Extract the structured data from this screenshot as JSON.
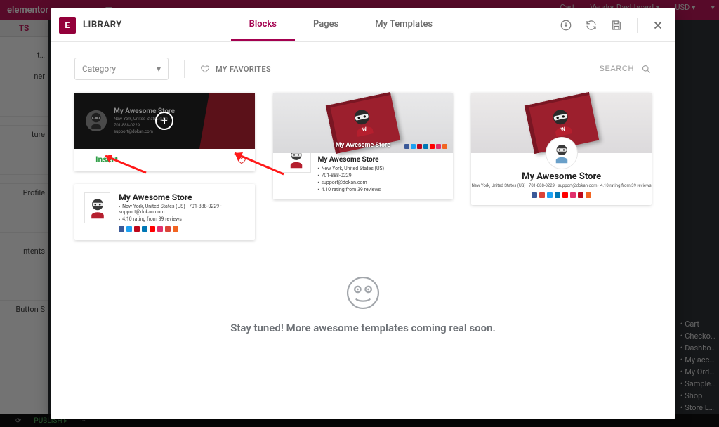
{
  "bg": {
    "brand": "elementor",
    "top_right": [
      "Cart",
      "Vendor Dashboard ▾",
      "USD ▾",
      "▾"
    ],
    "sidebar_segments": [
      "TS",
      "",
      "t…",
      "ner",
      "",
      "ture",
      "",
      "Profile",
      "",
      "ntents",
      "",
      "Button     S"
    ],
    "right_links": [
      "Cart",
      "Checko…",
      "Dashbo…",
      "My acc…",
      "My Ord…",
      "Sample…",
      "Shop",
      "Store L…"
    ],
    "bottom": [
      "⟳",
      "PUBLISH ▸",
      "···"
    ]
  },
  "modal": {
    "brand_badge": "E",
    "title": "LIBRARY",
    "tabs": {
      "blocks": "Blocks",
      "pages": "Pages",
      "my_templates": "My Templates",
      "active": "blocks"
    },
    "header_icons": {
      "import": "import-icon",
      "sync": "sync-icon",
      "save": "save-icon",
      "close": "close-icon"
    },
    "category_label": "Category",
    "favorites_label": "MY FAVORITES",
    "search_placeholder": "SEARCH"
  },
  "store": {
    "name": "My Awesome Store",
    "loc": "New York, United States (US)",
    "phone": "701-888-0229",
    "email": "support@dokan.com",
    "rating": "4.10 rating from 39 reviews",
    "c3_sub": "New York, United States (US) · 701-888-0229 · support@dokan.com · 4.10 rating from 39 reviews",
    "c4_line1": "New York, United States (US)  ·  701-888-0229  ·  support@dokan.com"
  },
  "card1": {
    "insert_label": "Insert"
  },
  "empty": {
    "text": "Stay tuned! More awesome templates coming real soon."
  }
}
